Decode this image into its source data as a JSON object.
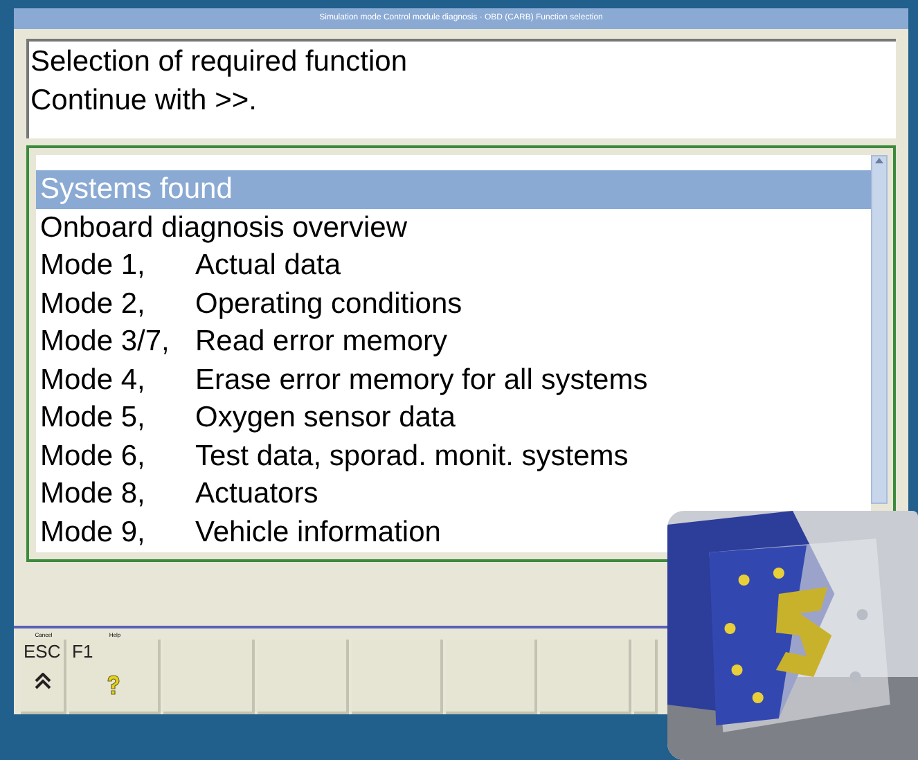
{
  "window": {
    "title": "Simulation mode Control module diagnosis · OBD (CARB) Function selection"
  },
  "message": [
    "Selection of required function",
    "Continue with >>."
  ],
  "functions": [
    {
      "label": "Systems found",
      "selected": true
    },
    {
      "label": "Onboard diagnosis overview",
      "selected": false
    },
    {
      "mode": "Mode 1,",
      "description": "Actual data",
      "selected": false
    },
    {
      "mode": "Mode 2,",
      "description": "Operating conditions",
      "selected": false
    },
    {
      "mode": "Mode 3/7,",
      "description": "Read error memory",
      "selected": false
    },
    {
      "mode": "Mode 4,",
      "description": "Erase error memory for all systems",
      "selected": false
    },
    {
      "mode": "Mode 5,",
      "description": "Oxygen sensor data",
      "selected": false
    },
    {
      "mode": "Mode 6,",
      "description": "Test data, sporad. monit. systems",
      "selected": false
    },
    {
      "mode": "Mode 8,",
      "description": "Actuators",
      "selected": false
    },
    {
      "mode": "Mode 9,",
      "description": "Vehicle information",
      "selected": false
    }
  ],
  "keys": [
    {
      "kind": "cancel",
      "caption": "Cancel",
      "key": "ESC"
    },
    {
      "kind": "help",
      "caption": "Help",
      "key": "F1"
    },
    {
      "kind": "empty"
    },
    {
      "kind": "empty"
    },
    {
      "kind": "empty"
    },
    {
      "kind": "empty"
    },
    {
      "kind": "empty"
    },
    {
      "kind": "empty"
    }
  ]
}
